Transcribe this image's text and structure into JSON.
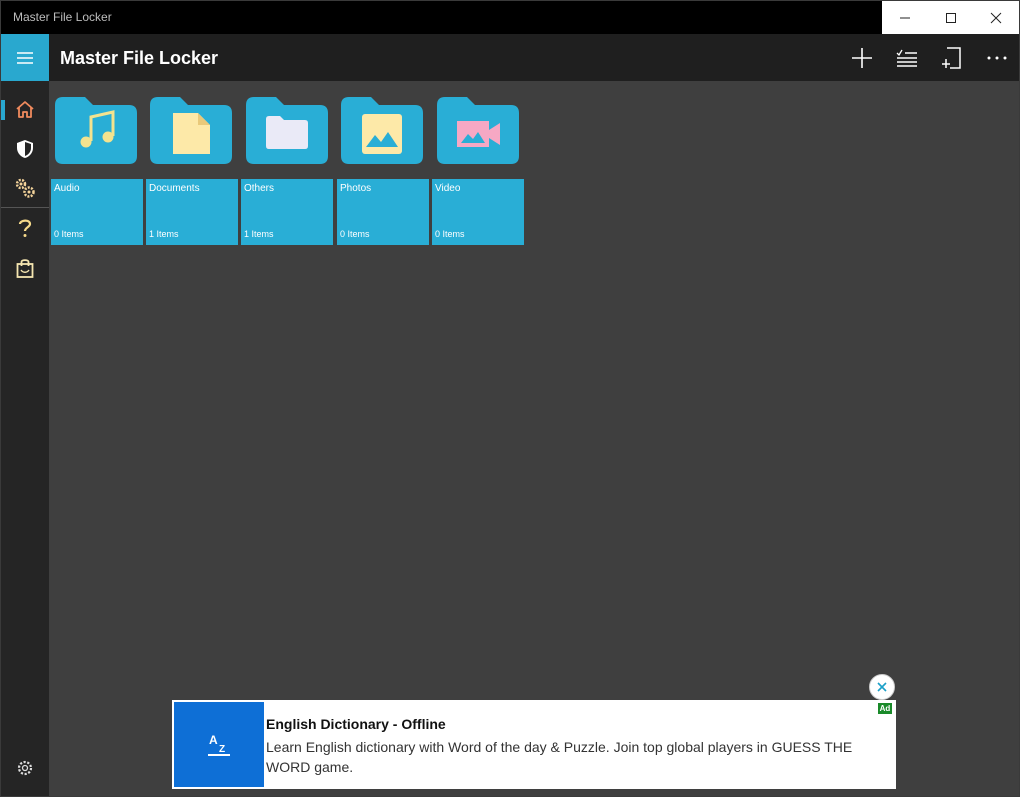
{
  "window": {
    "title": "Master File Locker"
  },
  "appbar": {
    "title": "Master File Locker",
    "menu_icon": "hamburger-icon",
    "actions": [
      {
        "name": "add-button",
        "icon": "plus-icon"
      },
      {
        "name": "select-button",
        "icon": "checklist-icon"
      },
      {
        "name": "import-button",
        "icon": "add-document-icon"
      },
      {
        "name": "more-button",
        "icon": "more-icon"
      }
    ]
  },
  "sidebar": {
    "items": [
      {
        "name": "home",
        "icon": "home-icon",
        "active": true
      },
      {
        "name": "security",
        "icon": "shield-icon"
      },
      {
        "name": "tools",
        "icon": "gears-icon"
      },
      {
        "name": "help",
        "icon": "question-icon"
      },
      {
        "name": "store",
        "icon": "shopping-bag-icon"
      },
      {
        "name": "settings",
        "icon": "settings-icon"
      }
    ]
  },
  "categories": [
    {
      "name": "Audio",
      "count": "0 Items",
      "icon": "music-note-icon",
      "icon_color": "#f3e38f"
    },
    {
      "name": "Documents",
      "count": "1 Items",
      "icon": "document-icon",
      "icon_color": "#fde9a8"
    },
    {
      "name": "Others",
      "count": "1 Items",
      "icon": "folder-icon",
      "icon_color": "#eaeaf7"
    },
    {
      "name": "Photos",
      "count": "0 Items",
      "icon": "image-icon",
      "icon_color": "#fde9a8"
    },
    {
      "name": "Video",
      "count": "0 Items",
      "icon": "video-camera-icon",
      "icon_color": "#f6a8c4"
    }
  ],
  "ad": {
    "title": "English Dictionary - Offline",
    "description": "Learn English dictionary with Word of the day & Puzzle. Join top global players in GUESS THE WORD game.",
    "badge": "Ad",
    "icon": "az-dictionary-icon"
  },
  "colors": {
    "accent": "#29a8cf",
    "tile": "#29aed6",
    "home_active": "#f08a5d"
  }
}
